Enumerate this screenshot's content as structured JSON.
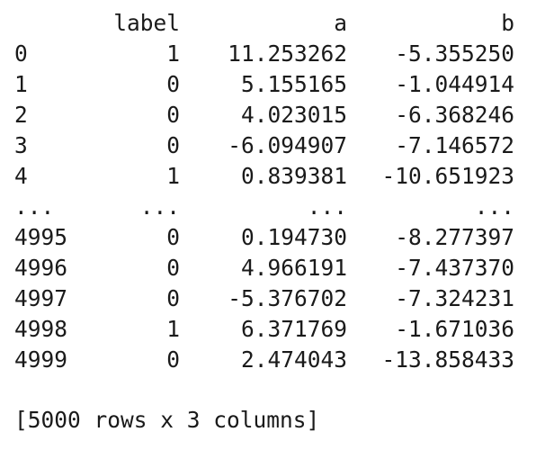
{
  "dataframe": {
    "columns": [
      "",
      "label",
      "a",
      "b"
    ],
    "rows": [
      [
        "0",
        "1",
        "11.253262",
        "-5.355250"
      ],
      [
        "1",
        "0",
        "5.155165",
        "-1.044914"
      ],
      [
        "2",
        "0",
        "4.023015",
        "-6.368246"
      ],
      [
        "3",
        "0",
        "-6.094907",
        "-7.146572"
      ],
      [
        "4",
        "1",
        "0.839381",
        "-10.651923"
      ],
      [
        "...",
        "...",
        "...",
        "..."
      ],
      [
        "4995",
        "0",
        "0.194730",
        "-8.277397"
      ],
      [
        "4996",
        "0",
        "4.966191",
        "-7.437370"
      ],
      [
        "4997",
        "0",
        "-5.376702",
        "-7.324231"
      ],
      [
        "4998",
        "1",
        "6.371769",
        "-1.671036"
      ],
      [
        "4999",
        "0",
        "2.474043",
        "-13.858433"
      ]
    ],
    "shape_summary": "[5000 rows x 3 columns]"
  }
}
